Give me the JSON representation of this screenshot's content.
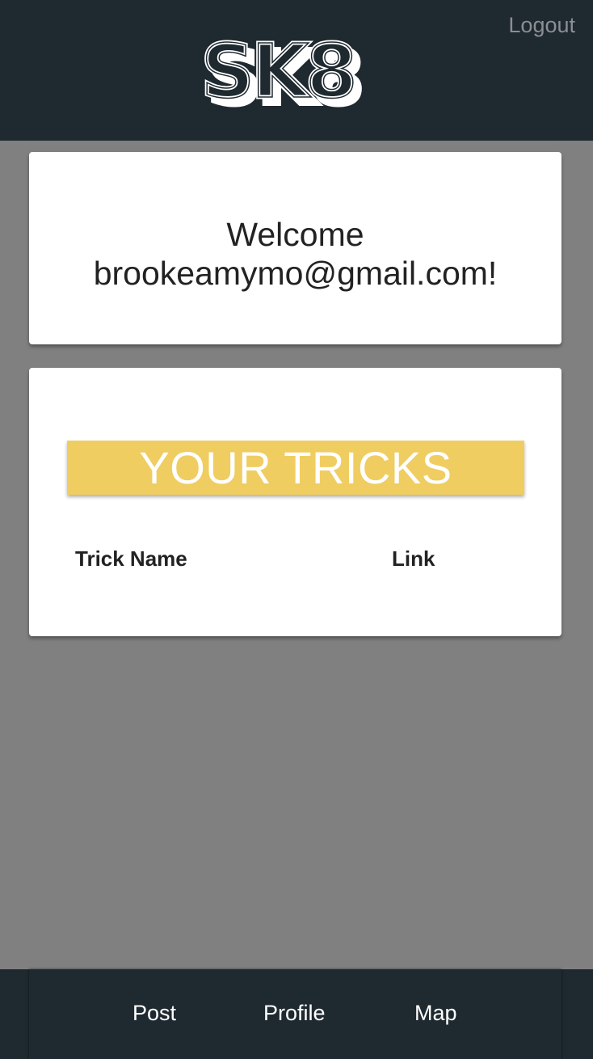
{
  "header": {
    "logo_text": "SK8",
    "logout_label": "Logout"
  },
  "welcome": {
    "line1": "Welcome",
    "line2": "brookeamymo@gmail.com!"
  },
  "tricks": {
    "title": "YOUR TRICKS",
    "columns": [
      "Trick Name",
      "Link"
    ]
  },
  "nav": {
    "items": [
      "Post",
      "Profile",
      "Map"
    ]
  },
  "colors": {
    "header_bg": "#1f2930",
    "page_bg": "#808080",
    "banner": "#f0cd60",
    "logout_text": "#8a8f93"
  }
}
